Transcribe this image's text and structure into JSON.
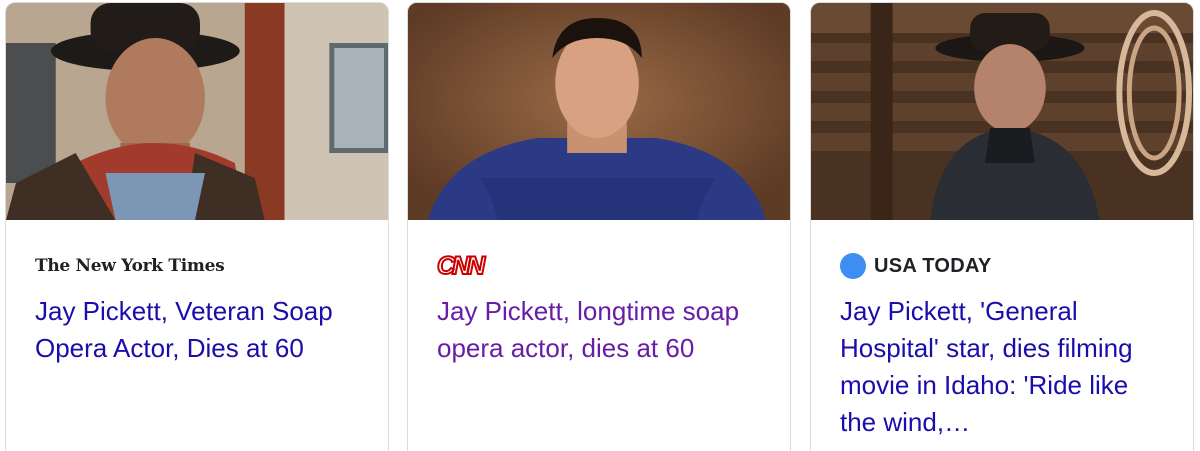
{
  "cards": [
    {
      "source": "The New York Times",
      "headline": "Jay Pickett, Veteran Soap Opera Actor, Dies at 60",
      "headline_color": "#1a0dab"
    },
    {
      "source": "CNN",
      "headline": "Jay Pickett, longtime soap opera actor, dies at 60",
      "headline_color": "#681da8"
    },
    {
      "source": "USA TODAY",
      "headline": "Jay Pickett, 'General Hospital' star, dies filming movie in Idaho: 'Ride like the wind,…",
      "headline_color": "#1a0dab"
    }
  ],
  "colors": {
    "link": "#1a0dab",
    "visited_link": "#681da8",
    "cnn_red": "#cc0000",
    "usa_today_blue": "#3d8ef0",
    "card_border": "#dadce0"
  }
}
